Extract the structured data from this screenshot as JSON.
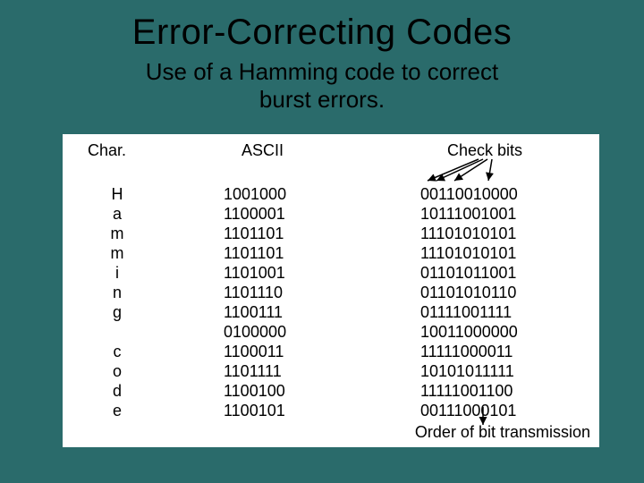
{
  "title": "Error-Correcting Codes",
  "subtitle_l1": "Use of a Hamming code to correct",
  "subtitle_l2": "burst errors.",
  "headers": {
    "char": "Char.",
    "ascii": "ASCII",
    "check": "Check bits"
  },
  "rows": {
    "char": "H\na\nm\nm\ni\nn\ng\n\nc\no\nd\ne",
    "ascii": "1001000\n1100001\n1101101\n1101101\n1101001\n1101110\n1100111\n0100000\n1100011\n1101111\n1100100\n1100101",
    "check": "00110010000\n10111001001\n11101010101\n11101010101\n01101011001\n01101010110\n01111001111\n10011000000\n11111000011\n10101011111\n11111001100\n00111000101"
  },
  "caption": "Order of bit transmission"
}
